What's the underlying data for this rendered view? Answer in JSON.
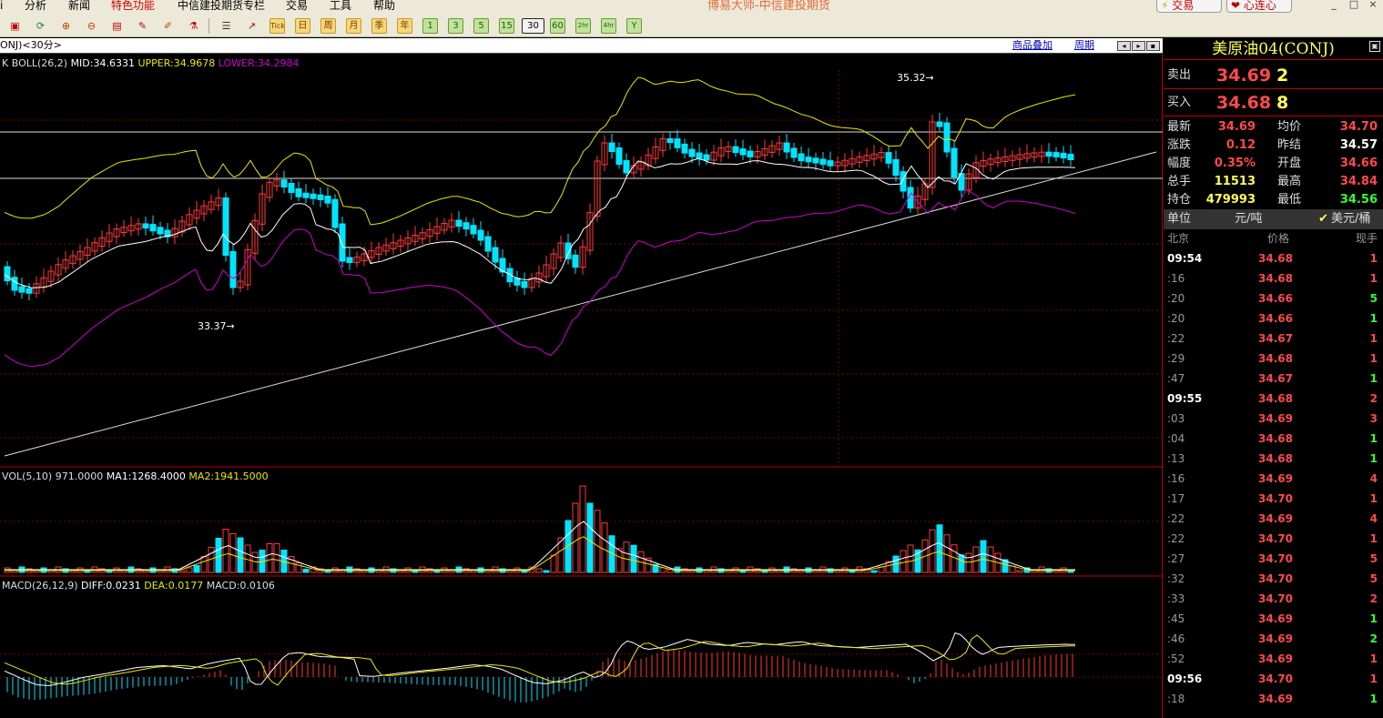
{
  "window": {
    "title": "博易大师-中信建投期货",
    "trade_button": "交易",
    "heart_button": "心连心"
  },
  "menu": [
    "分析",
    "新闻",
    "特色功能",
    "中信建投期货专栏",
    "交易",
    "工具",
    "帮助"
  ],
  "toolbar": {
    "periods": [
      "日",
      "周",
      "月",
      "季",
      "年",
      "1",
      "3",
      "5",
      "15",
      "30",
      "60",
      "2hr",
      "4hr",
      "Y"
    ],
    "selected": "30",
    "tick": "Tick"
  },
  "chart": {
    "symbol_tag": "ONJ)<30分>",
    "overlay_link": "商品叠加",
    "period_link": "周期",
    "boll_label": "K  BOLL(26,2)",
    "boll_mid": "MID:34.6331",
    "boll_upper": "UPPER:34.9678",
    "boll_lower": "LOWER:34.2984",
    "high_marker": "35.32",
    "low_marker": "33.37",
    "vol_label": "VOL(5,10)",
    "vol_value": "971.0000",
    "vol_ma1": "MA1:1268.4000",
    "vol_ma2": "MA2:1941.5000",
    "macd_label": "MACD(26,12,9)",
    "macd_diff": "DIFF:0.0231",
    "macd_dea": "DEA:0.0177",
    "macd_val": "MACD:0.0106",
    "colors": {
      "up": "#ff3a3a",
      "down": "#00e5ff",
      "mid": "#ffffff",
      "upper": "#e8e800",
      "lower": "#d000d0"
    }
  },
  "quote": {
    "title": "美原油04(CONJ)",
    "sell_label": "卖出",
    "sell_price": "34.69",
    "sell_qty": "2",
    "buy_label": "买入",
    "buy_price": "34.68",
    "buy_qty": "8",
    "stats": [
      {
        "l1": "最新",
        "v1": "34.69",
        "c1": "#ff4a4a",
        "l2": "均价",
        "v2": "34.70",
        "c2": "#ff4a4a"
      },
      {
        "l1": "涨跌",
        "v1": "0.12",
        "c1": "#ff4a4a",
        "l2": "昨结",
        "v2": "34.57",
        "c2": "#ffffff"
      },
      {
        "l1": "幅度",
        "v1": "0.35%",
        "c1": "#ff4a4a",
        "l2": "开盘",
        "v2": "34.66",
        "c2": "#ff4a4a"
      },
      {
        "l1": "总手",
        "v1": "11513",
        "c1": "#ffff55",
        "l2": "最高",
        "v2": "34.84",
        "c2": "#ff4a4a"
      },
      {
        "l1": "持仓",
        "v1": "479993",
        "c1": "#ffff55",
        "l2": "最低",
        "v2": "34.56",
        "c2": "#33ff33"
      }
    ],
    "unit_label": "单位",
    "unit_cny": "元/吨",
    "unit_usd": "美元/桶",
    "head_time": "北京",
    "head_price": "价格",
    "head_vol": "现手",
    "trades": [
      {
        "time": "09:54",
        "price": "34.68",
        "vol": "1",
        "up": false
      },
      {
        "time": ":16",
        "price": "34.68",
        "vol": "1",
        "up": false
      },
      {
        "time": ":20",
        "price": "34.66",
        "vol": "5",
        "up": true
      },
      {
        "time": ":20",
        "price": "34.66",
        "vol": "1",
        "up": true
      },
      {
        "time": ":22",
        "price": "34.67",
        "vol": "1",
        "up": false
      },
      {
        "time": ":29",
        "price": "34.68",
        "vol": "1",
        "up": false
      },
      {
        "time": ":47",
        "price": "34.67",
        "vol": "1",
        "up": true
      },
      {
        "time": "09:55",
        "price": "34.68",
        "vol": "2",
        "up": false
      },
      {
        "time": ":03",
        "price": "34.69",
        "vol": "3",
        "up": false
      },
      {
        "time": ":04",
        "price": "34.68",
        "vol": "1",
        "up": true
      },
      {
        "time": ":13",
        "price": "34.68",
        "vol": "1",
        "up": true
      },
      {
        "time": ":16",
        "price": "34.69",
        "vol": "4",
        "up": false
      },
      {
        "time": ":17",
        "price": "34.70",
        "vol": "1",
        "up": false
      },
      {
        "time": ":22",
        "price": "34.69",
        "vol": "4",
        "up": false
      },
      {
        "time": ":22",
        "price": "34.70",
        "vol": "1",
        "up": false
      },
      {
        "time": ":27",
        "price": "34.70",
        "vol": "5",
        "up": false
      },
      {
        "time": ":32",
        "price": "34.70",
        "vol": "5",
        "up": false
      },
      {
        "time": ":33",
        "price": "34.70",
        "vol": "2",
        "up": false
      },
      {
        "time": ":45",
        "price": "34.69",
        "vol": "1",
        "up": true
      },
      {
        "time": ":46",
        "price": "34.69",
        "vol": "2",
        "up": true
      },
      {
        "time": ":52",
        "price": "34.69",
        "vol": "1",
        "up": false
      },
      {
        "time": "09:56",
        "price": "34.70",
        "vol": "1",
        "up": false
      },
      {
        "time": ":18",
        "price": "34.69",
        "vol": "1",
        "up": true
      }
    ]
  }
}
